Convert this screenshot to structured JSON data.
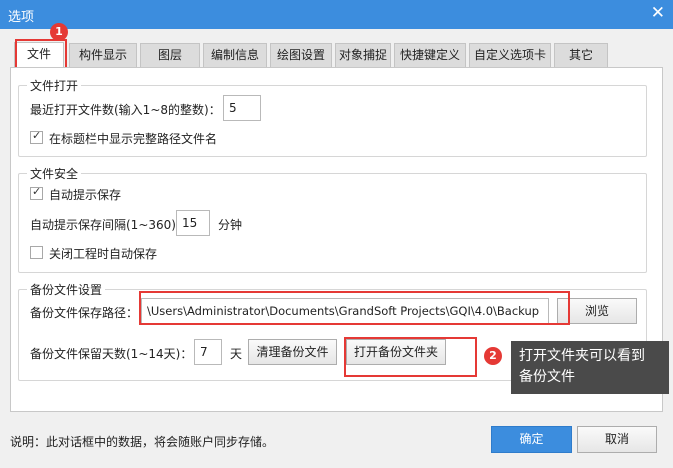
{
  "window": {
    "title": "选项"
  },
  "tabs": [
    {
      "label": "文件",
      "active": true
    },
    {
      "label": "构件显示"
    },
    {
      "label": "图层"
    },
    {
      "label": "编制信息"
    },
    {
      "label": "绘图设置"
    },
    {
      "label": "对象捕捉"
    },
    {
      "label": "快捷键定义"
    },
    {
      "label": "自定义选项卡"
    },
    {
      "label": "其它"
    }
  ],
  "file_open": {
    "title": "文件打开",
    "recent_label": "最近打开文件数(输入1~8的整数)：",
    "recent_value": "5",
    "show_full_path_label": "在标题栏中显示完整路径文件名",
    "show_full_path_checked": true
  },
  "file_security": {
    "title": "文件安全",
    "auto_save_prompt_label": "自动提示保存",
    "auto_save_prompt_checked": true,
    "interval_label": "自动提示保存间隔(1~360)",
    "interval_value": "15",
    "interval_unit": "分钟",
    "save_on_close_label": "关闭工程时自动保存",
    "save_on_close_checked": false
  },
  "backup": {
    "title": "备份文件设置",
    "path_label": "备份文件保存路径：",
    "path_value": "\\Users\\Administrator\\Documents\\GrandSoft Projects\\GQI\\4.0\\Backup",
    "browse_label": "浏览",
    "days_label": "备份文件保留天数(1~14天)：",
    "days_value": "7",
    "days_unit": "天",
    "clean_label": "清理备份文件",
    "open_folder_label": "打开备份文件夹"
  },
  "annotations": {
    "badge1": "1",
    "badge2": "2",
    "tooltip_line1": "打开文件夹可以看到",
    "tooltip_line2": "备份文件"
  },
  "footer": {
    "note": "说明：此对话框中的数据，将会随账户同步存储。",
    "ok_label": "确定",
    "cancel_label": "取消"
  },
  "colors": {
    "titlebar": "#3c8dde",
    "primary_button": "#3c8dde",
    "highlight": "#e53935",
    "tooltip": "#4a4a4a"
  },
  "icons": {
    "close": "close-icon",
    "check": "check-icon"
  }
}
